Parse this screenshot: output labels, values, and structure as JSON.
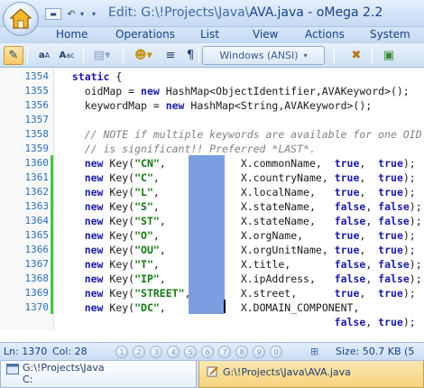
{
  "window": {
    "title_prefix": "Edit: G:\\!Projects\\Java\\",
    "title_file": "AVA.java",
    "title_suffix": " - oMega 2.2"
  },
  "ribbon": {
    "tabs": [
      "Home",
      "Operations",
      "List",
      "View",
      "Actions",
      "System"
    ]
  },
  "toolbar": {
    "encoding": "Windows (ANSI)"
  },
  "editor": {
    "line_numbers": [
      "1354",
      "1355",
      "1356",
      "1357",
      "1358",
      "1359",
      "1360",
      "1361",
      "1362",
      "1363",
      "1364",
      "1365",
      "1366",
      "1367",
      "1368",
      "1369",
      "1370",
      ""
    ],
    "lines": [
      "  static {",
      "    oidMap = new HashMap<ObjectIdentifier,AVAKeyword>();",
      "    keywordMap = new HashMap<String,AVAKeyword>();",
      "",
      "    // NOTE if multiple keywords are available for one OID",
      "    // is significant!! Preferred *LAST*.",
      "    new Key(\"CN\",            X.commonName,  true,  true);",
      "    new Key(\"C\",             X.countryName, true,  true);",
      "    new Key(\"L\",             X.localName,   true,  true);",
      "    new Key(\"S\",             X.stateName,   false, false);",
      "    new Key(\"ST\",            X.stateName,   false, false);",
      "    new Key(\"O\",             X.orgName,     true,  true);",
      "    new Key(\"OU\",            X.orgUnitName, true,  true);",
      "    new Key(\"T\",             X.title,       false, false);",
      "    new Key(\"IP\",            X.ipAddress,   false, false);",
      "    new Key(\"STREET\",        X.street,      true,  true);",
      "    new Key(\"DC\",            X.DOMAIN_COMPONENT,",
      "                                            false, true);"
    ]
  },
  "status": {
    "line": "Ln: 1370",
    "col": "Col: 28",
    "bookmarks": [
      "1",
      "2",
      "3",
      "4",
      "5",
      "6",
      "7",
      "8",
      "9",
      "0"
    ],
    "size": "Size: 50.7 KB (5"
  },
  "doctabs": {
    "folder_line1": "G:\\!Projects\\Java",
    "folder_line2": "C:",
    "file": "G:\\!Projects\\Java\\AVA.java"
  }
}
